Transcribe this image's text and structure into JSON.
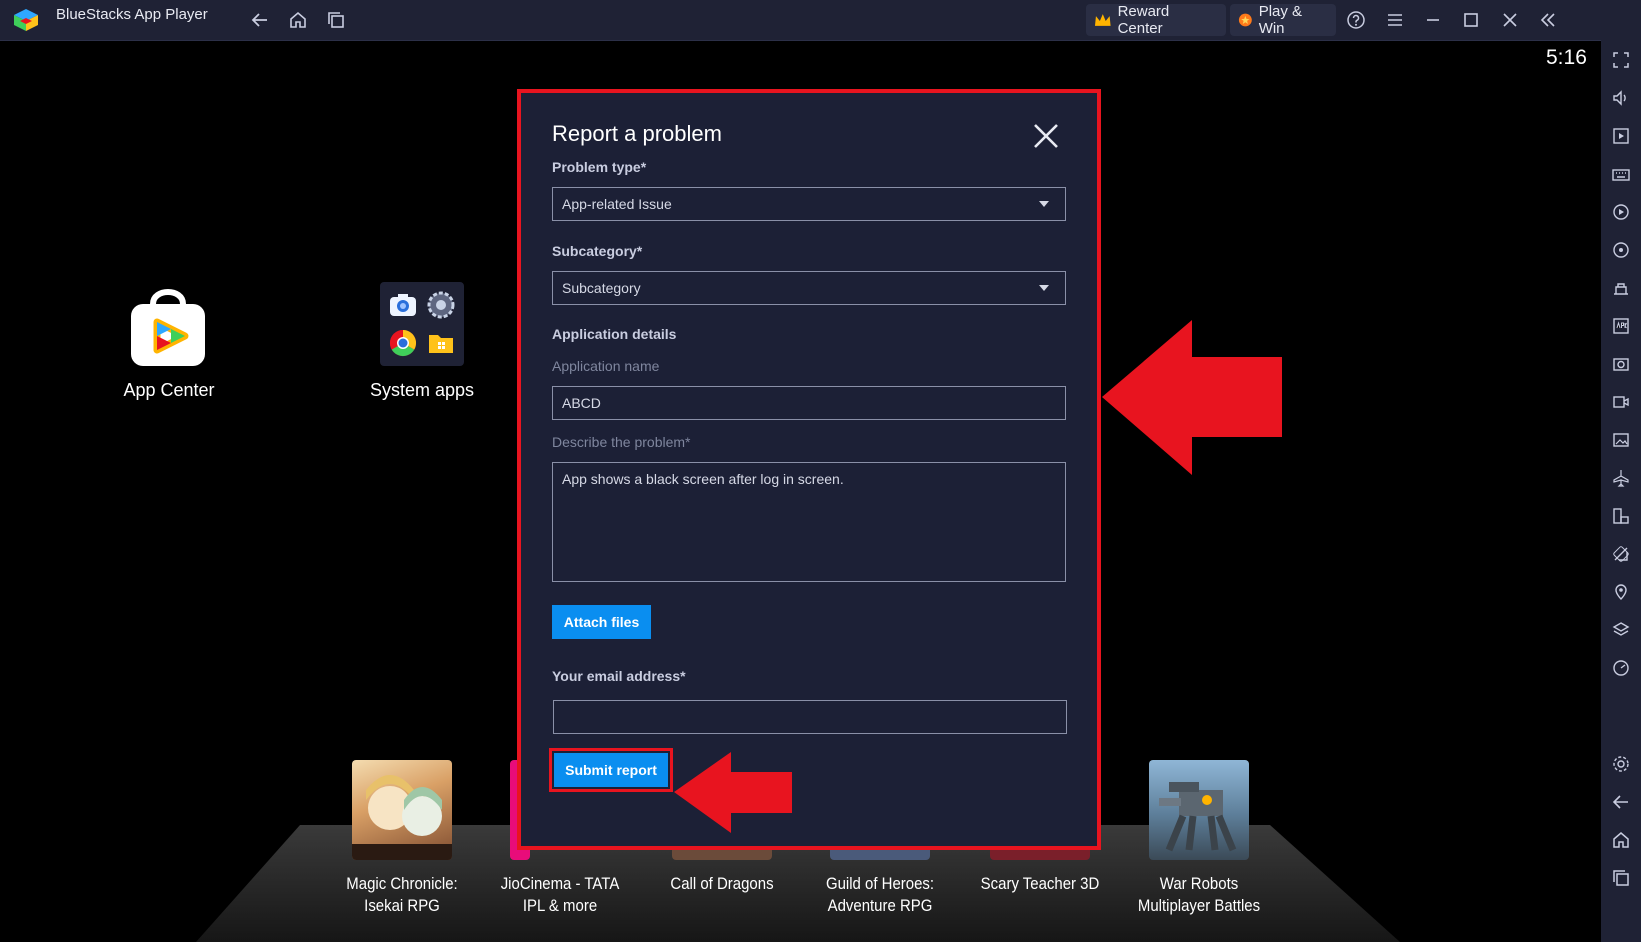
{
  "titlebar": {
    "app_title": "BlueStacks App Player",
    "reward_center": "Reward Center",
    "play_win": "Play & Win"
  },
  "clock": "5:16",
  "desktop": {
    "app_center": "App Center",
    "system_apps": "System apps"
  },
  "games": [
    {
      "line1": "Magic Chronicle:",
      "line2": "Isekai RPG"
    },
    {
      "line1": "JioCinema - TATA",
      "line2": "IPL & more"
    },
    {
      "line1": "Call of Dragons",
      "line2": ""
    },
    {
      "line1": "Guild of Heroes:",
      "line2": "Adventure RPG"
    },
    {
      "line1": "Scary Teacher 3D",
      "line2": ""
    },
    {
      "line1": "War Robots",
      "line2": "Multiplayer Battles"
    }
  ],
  "dialog": {
    "title": "Report a problem",
    "problem_type_label": "Problem type*",
    "problem_type_value": "App-related Issue",
    "subcategory_label": "Subcategory*",
    "subcategory_value": "Subcategory",
    "app_details_label": "Application details",
    "app_name_label": "Application name",
    "app_name_value": "ABCD",
    "describe_label": "Describe the problem*",
    "describe_value": "App shows a black screen after log in screen.",
    "attach_button": "Attach files",
    "email_label": "Your email address*",
    "email_value": "",
    "submit_button": "Submit report"
  },
  "colors": {
    "highlight": "#e8141f",
    "accent": "#0a8ef0",
    "dialog_bg": "#1c2036",
    "chrome_bg": "#1f2235"
  }
}
